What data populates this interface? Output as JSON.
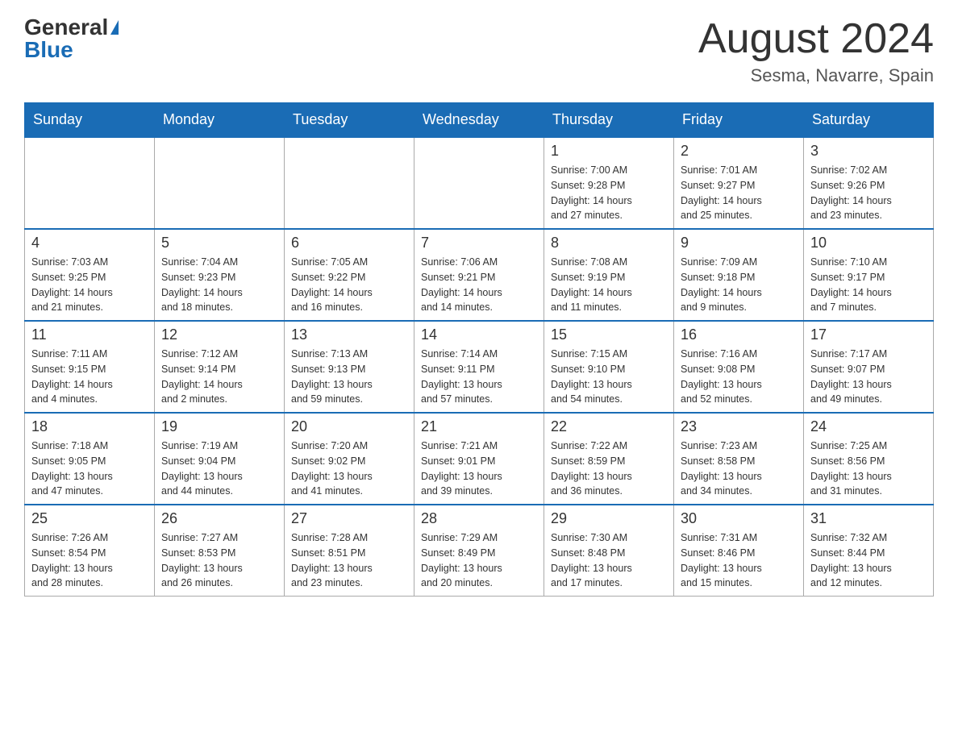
{
  "header": {
    "logo_general": "General",
    "logo_blue": "Blue",
    "month_title": "August 2024",
    "location": "Sesma, Navarre, Spain"
  },
  "weekdays": [
    "Sunday",
    "Monday",
    "Tuesday",
    "Wednesday",
    "Thursday",
    "Friday",
    "Saturday"
  ],
  "weeks": [
    [
      {
        "day": "",
        "info": ""
      },
      {
        "day": "",
        "info": ""
      },
      {
        "day": "",
        "info": ""
      },
      {
        "day": "",
        "info": ""
      },
      {
        "day": "1",
        "info": "Sunrise: 7:00 AM\nSunset: 9:28 PM\nDaylight: 14 hours\nand 27 minutes."
      },
      {
        "day": "2",
        "info": "Sunrise: 7:01 AM\nSunset: 9:27 PM\nDaylight: 14 hours\nand 25 minutes."
      },
      {
        "day": "3",
        "info": "Sunrise: 7:02 AM\nSunset: 9:26 PM\nDaylight: 14 hours\nand 23 minutes."
      }
    ],
    [
      {
        "day": "4",
        "info": "Sunrise: 7:03 AM\nSunset: 9:25 PM\nDaylight: 14 hours\nand 21 minutes."
      },
      {
        "day": "5",
        "info": "Sunrise: 7:04 AM\nSunset: 9:23 PM\nDaylight: 14 hours\nand 18 minutes."
      },
      {
        "day": "6",
        "info": "Sunrise: 7:05 AM\nSunset: 9:22 PM\nDaylight: 14 hours\nand 16 minutes."
      },
      {
        "day": "7",
        "info": "Sunrise: 7:06 AM\nSunset: 9:21 PM\nDaylight: 14 hours\nand 14 minutes."
      },
      {
        "day": "8",
        "info": "Sunrise: 7:08 AM\nSunset: 9:19 PM\nDaylight: 14 hours\nand 11 minutes."
      },
      {
        "day": "9",
        "info": "Sunrise: 7:09 AM\nSunset: 9:18 PM\nDaylight: 14 hours\nand 9 minutes."
      },
      {
        "day": "10",
        "info": "Sunrise: 7:10 AM\nSunset: 9:17 PM\nDaylight: 14 hours\nand 7 minutes."
      }
    ],
    [
      {
        "day": "11",
        "info": "Sunrise: 7:11 AM\nSunset: 9:15 PM\nDaylight: 14 hours\nand 4 minutes."
      },
      {
        "day": "12",
        "info": "Sunrise: 7:12 AM\nSunset: 9:14 PM\nDaylight: 14 hours\nand 2 minutes."
      },
      {
        "day": "13",
        "info": "Sunrise: 7:13 AM\nSunset: 9:13 PM\nDaylight: 13 hours\nand 59 minutes."
      },
      {
        "day": "14",
        "info": "Sunrise: 7:14 AM\nSunset: 9:11 PM\nDaylight: 13 hours\nand 57 minutes."
      },
      {
        "day": "15",
        "info": "Sunrise: 7:15 AM\nSunset: 9:10 PM\nDaylight: 13 hours\nand 54 minutes."
      },
      {
        "day": "16",
        "info": "Sunrise: 7:16 AM\nSunset: 9:08 PM\nDaylight: 13 hours\nand 52 minutes."
      },
      {
        "day": "17",
        "info": "Sunrise: 7:17 AM\nSunset: 9:07 PM\nDaylight: 13 hours\nand 49 minutes."
      }
    ],
    [
      {
        "day": "18",
        "info": "Sunrise: 7:18 AM\nSunset: 9:05 PM\nDaylight: 13 hours\nand 47 minutes."
      },
      {
        "day": "19",
        "info": "Sunrise: 7:19 AM\nSunset: 9:04 PM\nDaylight: 13 hours\nand 44 minutes."
      },
      {
        "day": "20",
        "info": "Sunrise: 7:20 AM\nSunset: 9:02 PM\nDaylight: 13 hours\nand 41 minutes."
      },
      {
        "day": "21",
        "info": "Sunrise: 7:21 AM\nSunset: 9:01 PM\nDaylight: 13 hours\nand 39 minutes."
      },
      {
        "day": "22",
        "info": "Sunrise: 7:22 AM\nSunset: 8:59 PM\nDaylight: 13 hours\nand 36 minutes."
      },
      {
        "day": "23",
        "info": "Sunrise: 7:23 AM\nSunset: 8:58 PM\nDaylight: 13 hours\nand 34 minutes."
      },
      {
        "day": "24",
        "info": "Sunrise: 7:25 AM\nSunset: 8:56 PM\nDaylight: 13 hours\nand 31 minutes."
      }
    ],
    [
      {
        "day": "25",
        "info": "Sunrise: 7:26 AM\nSunset: 8:54 PM\nDaylight: 13 hours\nand 28 minutes."
      },
      {
        "day": "26",
        "info": "Sunrise: 7:27 AM\nSunset: 8:53 PM\nDaylight: 13 hours\nand 26 minutes."
      },
      {
        "day": "27",
        "info": "Sunrise: 7:28 AM\nSunset: 8:51 PM\nDaylight: 13 hours\nand 23 minutes."
      },
      {
        "day": "28",
        "info": "Sunrise: 7:29 AM\nSunset: 8:49 PM\nDaylight: 13 hours\nand 20 minutes."
      },
      {
        "day": "29",
        "info": "Sunrise: 7:30 AM\nSunset: 8:48 PM\nDaylight: 13 hours\nand 17 minutes."
      },
      {
        "day": "30",
        "info": "Sunrise: 7:31 AM\nSunset: 8:46 PM\nDaylight: 13 hours\nand 15 minutes."
      },
      {
        "day": "31",
        "info": "Sunrise: 7:32 AM\nSunset: 8:44 PM\nDaylight: 13 hours\nand 12 minutes."
      }
    ]
  ]
}
